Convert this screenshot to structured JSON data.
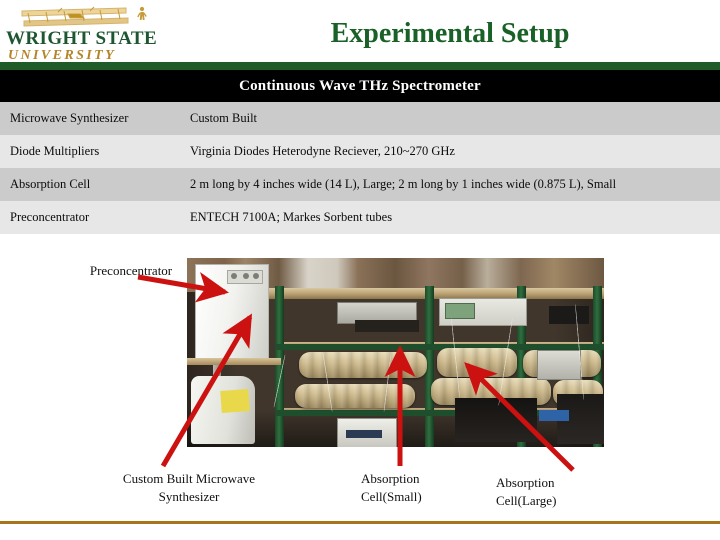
{
  "branding": {
    "university_name_line1": "WRIGHT STATE",
    "university_name_line2": "UNIVERSITY",
    "logo_icon": "wright-flyer-biplane-icon",
    "green": "#1f5c2a",
    "gold": "#b58427"
  },
  "header": {
    "title": "Experimental Setup",
    "title_color": "#1a6127"
  },
  "table": {
    "caption": "Continuous Wave THz Spectrometer",
    "rows": [
      {
        "component": "Microwave Synthesizer",
        "description": "Custom Built"
      },
      {
        "component": "Diode Multipliers",
        "description": "Virginia Diodes Heterodyne Reciever, 210~270 GHz"
      },
      {
        "component": "Absorption Cell",
        "description": "2 m long by 4 inches wide (14 L), Large; 2 m long by 1 inches wide (0.875 L), Small"
      },
      {
        "component": "Preconcentrator",
        "description": "ENTECH 7100A; Markes Sorbent tubes"
      }
    ]
  },
  "figure": {
    "photo_alt": "laboratory-bench-photo-thz-spectrometer",
    "annotation_color": "#cc1111",
    "callouts": [
      {
        "id": "preconcentrator",
        "label": "Preconcentrator"
      },
      {
        "id": "microwave-synthesizer",
        "label": "Custom Built Microwave\nSynthesizer"
      },
      {
        "id": "absorption-cell-small",
        "label": "Absorption\nCell(Small)"
      },
      {
        "id": "absorption-cell-large",
        "label": "Absorption\nCell(Large)"
      }
    ]
  },
  "footer": {
    "rule_color": "#a8741c"
  }
}
